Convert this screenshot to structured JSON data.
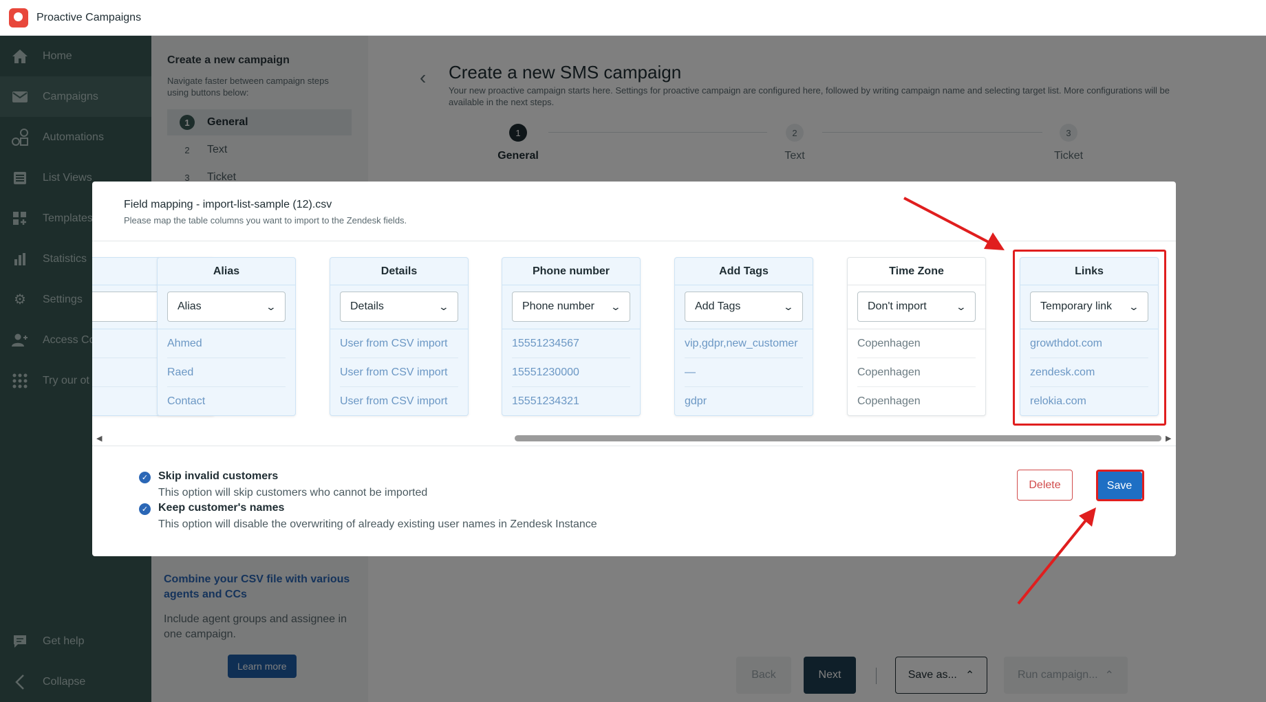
{
  "app": {
    "title": "Proactive Campaigns"
  },
  "sidebar": {
    "items": [
      {
        "label": "Home",
        "icon": "home-icon"
      },
      {
        "label": "Campaigns",
        "icon": "envelope-icon",
        "active": true
      },
      {
        "label": "Automations",
        "icon": "automation-icon"
      },
      {
        "label": "List Views",
        "icon": "list-icon"
      },
      {
        "label": "Templates",
        "icon": "templates-icon"
      },
      {
        "label": "Statistics",
        "icon": "bar-chart-icon"
      },
      {
        "label": "Settings",
        "icon": "gear-icon"
      },
      {
        "label": "Access Co",
        "icon": "user-access-icon"
      },
      {
        "label": "Try our ot",
        "icon": "apps-grid-icon"
      }
    ],
    "bottom": [
      {
        "label": "Get help",
        "icon": "chat-icon"
      },
      {
        "label": "Collapse",
        "icon": "chevron-left-icon"
      }
    ]
  },
  "stepsPanel": {
    "title": "Create a new campaign",
    "subtitle": "Navigate faster between campaign steps using buttons below:",
    "steps": [
      {
        "num": "1",
        "label": "General",
        "active": true
      },
      {
        "num": "2",
        "label": "Text"
      },
      {
        "num": "3",
        "label": "Ticket"
      }
    ],
    "promo": {
      "title": "Combine your CSV file with various agents and CCs",
      "text": "Include agent groups and assignee in one campaign.",
      "button": "Learn more"
    }
  },
  "main": {
    "title": "Create a new SMS campaign",
    "subtitle": "Your new proactive campaign starts here. Settings for proactive campaign are configured here, followed by writing campaign name and selecting target list. More configurations will be available in the next steps.",
    "steps": [
      {
        "num": "1",
        "label": "General"
      },
      {
        "num": "2",
        "label": "Text"
      },
      {
        "num": "3",
        "label": "Ticket"
      }
    ],
    "footer": {
      "back": "Back",
      "next": "Next",
      "saveAs": "Save as...",
      "run": "Run campaign..."
    }
  },
  "modal": {
    "title": "Field mapping - import-list-sample (12).csv",
    "subtitle": "Please map the table columns you want to import to the Zendesk fields.",
    "partialColumn": {
      "header": "e",
      "cells": [
        "n",
        "n",
        "n"
      ]
    },
    "columns": [
      {
        "header": "Alias",
        "selected": "Alias",
        "cells": [
          "Ahmed",
          "Raed",
          "Contact"
        ]
      },
      {
        "header": "Details",
        "selected": "Details",
        "cells": [
          "User from CSV import",
          "User from CSV import",
          "User from CSV import"
        ]
      },
      {
        "header": "Phone number",
        "selected": "Phone number",
        "cells": [
          "15551234567",
          "15551230000",
          "15551234321"
        ]
      },
      {
        "header": "Add Tags",
        "selected": "Add Tags",
        "cells": [
          "vip,gdpr,new_customer",
          "—",
          "gdpr"
        ]
      },
      {
        "header": "Time Zone",
        "selected": "Don't import",
        "cells": [
          "Copenhagen",
          "Copenhagen",
          "Copenhagen"
        ]
      },
      {
        "header": "Links",
        "selected": "Temporary link",
        "cells": [
          "growthdot.com",
          "zendesk.com",
          "relokia.com"
        ]
      }
    ],
    "options": [
      {
        "label": "Skip invalid customers",
        "description": "This option will skip customers who cannot be imported"
      },
      {
        "label": "Keep customer's names",
        "description": "This option will disable the overwriting of already existing user names in Zendesk Instance"
      }
    ],
    "buttons": {
      "delete": "Delete",
      "save": "Save"
    }
  },
  "colors": {
    "accent": "#1e6fc4",
    "sidebar": "#3a5b57",
    "highlight": "#e01e1e",
    "danger": "#d14b4b"
  }
}
